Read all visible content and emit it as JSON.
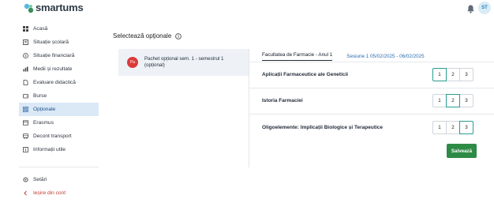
{
  "app": {
    "name": "smartums",
    "user_initials": "ST"
  },
  "sidebar": {
    "items": [
      {
        "label": "Acasă",
        "icon": "grid-icon"
      },
      {
        "label": "Situație școlară",
        "icon": "book-icon"
      },
      {
        "label": "Situație financiară",
        "icon": "dollar-icon"
      },
      {
        "label": "Medii și rezultate",
        "icon": "chart-icon"
      },
      {
        "label": "Evaluare didactică",
        "icon": "document-icon"
      },
      {
        "label": "Burse",
        "icon": "wallet-icon"
      },
      {
        "label": "Opționale",
        "icon": "options-icon"
      },
      {
        "label": "Erasmus",
        "icon": "globe-icon"
      },
      {
        "label": "Decont transport",
        "icon": "bus-icon"
      },
      {
        "label": "Informații utile",
        "icon": "info-icon"
      }
    ],
    "bottom": [
      {
        "label": "Setări",
        "icon": "gear-icon"
      },
      {
        "label": "Ieșire din cont",
        "icon": "logout-icon"
      }
    ]
  },
  "main": {
    "title": "Selectează opționale",
    "package": {
      "badge": "Pa",
      "line1": "Pachet opțional sem. 1 - semestrul 1",
      "line2": "(opțional)"
    },
    "faculty": "Facultatea de Farmacie - Anul 1",
    "session": "Sesiune 1 05/02/2025 - 06/02/2025",
    "courses": [
      {
        "name": "Aplicații Farmaceutice ale Geneticii",
        "options": [
          "1",
          "2",
          "3"
        ],
        "selected": "1"
      },
      {
        "name": "Istoria Farmaciei",
        "options": [
          "1",
          "2",
          "3"
        ],
        "selected": "2"
      },
      {
        "name": "Oligoelemente: Implicații Biologice și Terapeutice",
        "options": [
          "1",
          "2",
          "3"
        ],
        "selected": "3"
      }
    ],
    "save_label": "Salvează"
  },
  "colors": {
    "accent": "#2e8b45",
    "active_nav_bg": "#dbe9f7",
    "selected_border": "#2a9d8f",
    "badge_red": "#dc3a3a",
    "session_blue": "#2b6cb0"
  }
}
